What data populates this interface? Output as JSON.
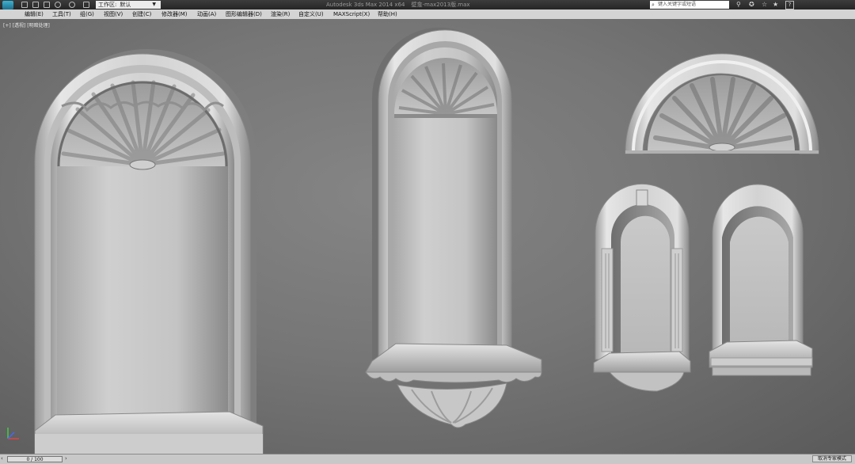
{
  "titlebar": {
    "workspace_label": "工作区:",
    "workspace_value": "默认",
    "app_title": "Autodesk 3ds Max  2014 x64",
    "file_name": "壁龛-max2013版.max",
    "search_placeholder": "键入关键字或短语"
  },
  "menu": [
    "编辑(E)",
    "工具(T)",
    "组(G)",
    "视图(V)",
    "创建(C)",
    "修改器(M)",
    "动画(A)",
    "图形编辑器(D)",
    "渲染(R)",
    "自定义(U)",
    "MAXScript(X)",
    "帮助(H)"
  ],
  "viewport": {
    "label": "[+] [透视] [明暗处理]"
  },
  "status": {
    "frame_counter": "0 / 100",
    "expert_mode": "取消专家模式"
  },
  "colors": {
    "accent": "#3db2d3",
    "viewport_bg": "#767676",
    "model": "#d8d8d8"
  }
}
